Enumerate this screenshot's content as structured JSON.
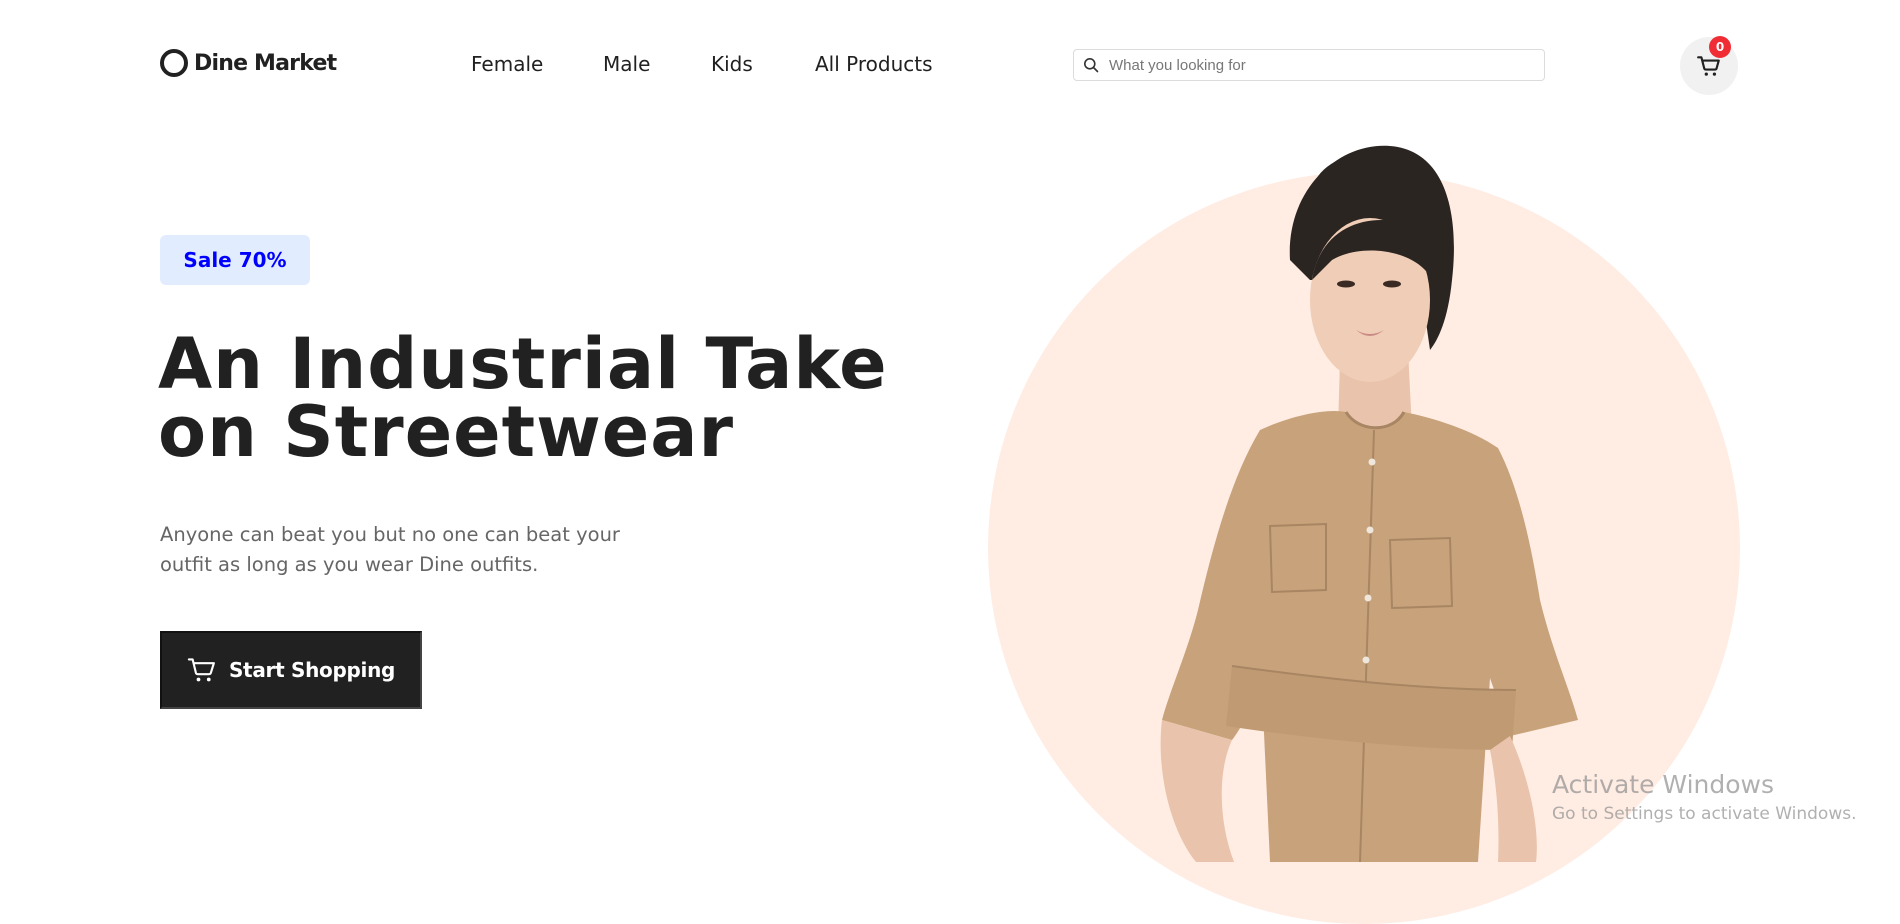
{
  "brand": {
    "name": "Dine Market"
  },
  "nav": {
    "items": [
      {
        "label": "Female"
      },
      {
        "label": "Male"
      },
      {
        "label": "Kids"
      },
      {
        "label": "All Products"
      }
    ]
  },
  "search": {
    "placeholder": "What you looking for",
    "value": "",
    "icon": "search-icon"
  },
  "cart": {
    "count": "0",
    "icon": "cart-icon",
    "badge_color": "#f02d34"
  },
  "hero": {
    "badge": "Sale 70%",
    "title_line1": "An Industrial Take",
    "title_line2": "on Streetwear",
    "desc_line1": "Anyone can beat you but no one can beat your",
    "desc_line2": "outfit as long as you wear Dine outfits.",
    "cta_label": "Start Shopping",
    "cta_icon": "cart-icon",
    "image": "model-in-beige-dress"
  },
  "watermark": {
    "title": "Activate Windows",
    "subtitle": "Go to Settings to activate Windows."
  },
  "colors": {
    "text": "#212121",
    "badge_bg": "#e1edff",
    "badge_text": "#0000ff",
    "button_bg": "#212121",
    "hero_circle": "#ffece3",
    "desc_text": "#666666"
  }
}
